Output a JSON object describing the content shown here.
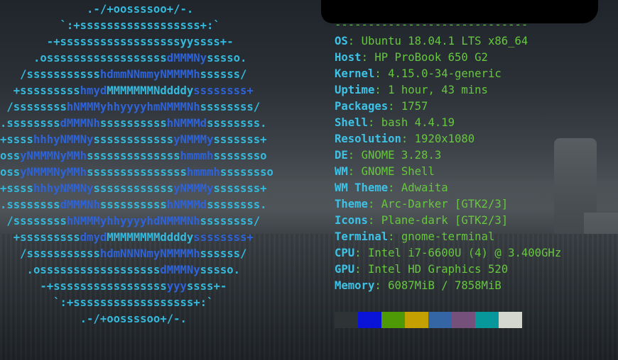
{
  "info": {
    "separator": "-----------------------------",
    "rows": [
      {
        "key": "OS",
        "value": "Ubuntu 18.04.1 LTS x86_64"
      },
      {
        "key": "Host",
        "value": "HP ProBook 650 G2"
      },
      {
        "key": "Kernel",
        "value": "4.15.0-34-generic"
      },
      {
        "key": "Uptime",
        "value": "1 hour, 43 mins"
      },
      {
        "key": "Packages",
        "value": "1757"
      },
      {
        "key": "Shell",
        "value": "bash 4.4.19"
      },
      {
        "key": "Resolution",
        "value": "1920x1080"
      },
      {
        "key": "DE",
        "value": "GNOME 3.28.3"
      },
      {
        "key": "WM",
        "value": "GNOME Shell"
      },
      {
        "key": "WM Theme",
        "value": "Adwaita"
      },
      {
        "key": "Theme",
        "value": "Arc-Darker [GTK2/3]"
      },
      {
        "key": "Icons",
        "value": "Plane-dark [GTK2/3]"
      },
      {
        "key": "Terminal",
        "value": "gnome-terminal"
      },
      {
        "key": "CPU",
        "value": "Intel i7-6600U (4) @ 3.400GHz"
      },
      {
        "key": "GPU",
        "value": "Intel HD Graphics 520"
      },
      {
        "key": "Memory",
        "value": "6087MiB / 7858MiB"
      }
    ]
  },
  "palette": [
    "#2e3436",
    "#0a14d8",
    "#4e9a06",
    "#c4a000",
    "#3465a4",
    "#75507b",
    "#06989a",
    "#d3d7cf"
  ],
  "logo": [
    "             .-/+oossssoo+/-.",
    "         `:+ssssssssssssssssss+:`",
    "       -+ssssssssssssssssssyyssss+-",
    "     .ossssssssssssssssss|dMMMNy|sssso.",
    "   /sssssssssss|hdmmNNmmyNMMMMh|ssssss/",
    "  +sssssssss|hmyd|MMMMMMMNddddy|ssssssss+",
    " /ssssssss|hNMMMyhhyyyyhmNMMMNh|ssssssss/",
    ".ssssssss|dMMMNh|ssssssssss|hNMMMd|ssssssss.",
    "+ssss|hhhyNMMNy|ssssssssssss|yNMMMy|sssssss+",
    "oss|yNMMMNyMMh|ssssssssssssss|hmmmh|ssssssso",
    "oss|yNMMMNyMMh|sssssssssssssss|hmmmh|ssssssso",
    "+ssss|hhhyNMMNy|ssssssssssss|yNMMMy|sssssss+",
    ".ssssssss|dMMMNh|ssssssssss|hNMMMd|ssssssss.",
    " /ssssssss|hNMMMyhhyyyyhdNMMMNh|ssssssss/",
    "  +sssssssss|dmyd|MMMMMMMMddddy|ssssssss+",
    "   /sssssssssss|hdmNNNNmyNMMMMh|ssssss/",
    "    .ossssssssssssssssss|dMMMNy|sssso.",
    "      -+sssssssssssssssss|yyy|ssss+-",
    "        `:+ssssssssssssssssss+:`",
    "            .-/+oossssoo+/-."
  ]
}
